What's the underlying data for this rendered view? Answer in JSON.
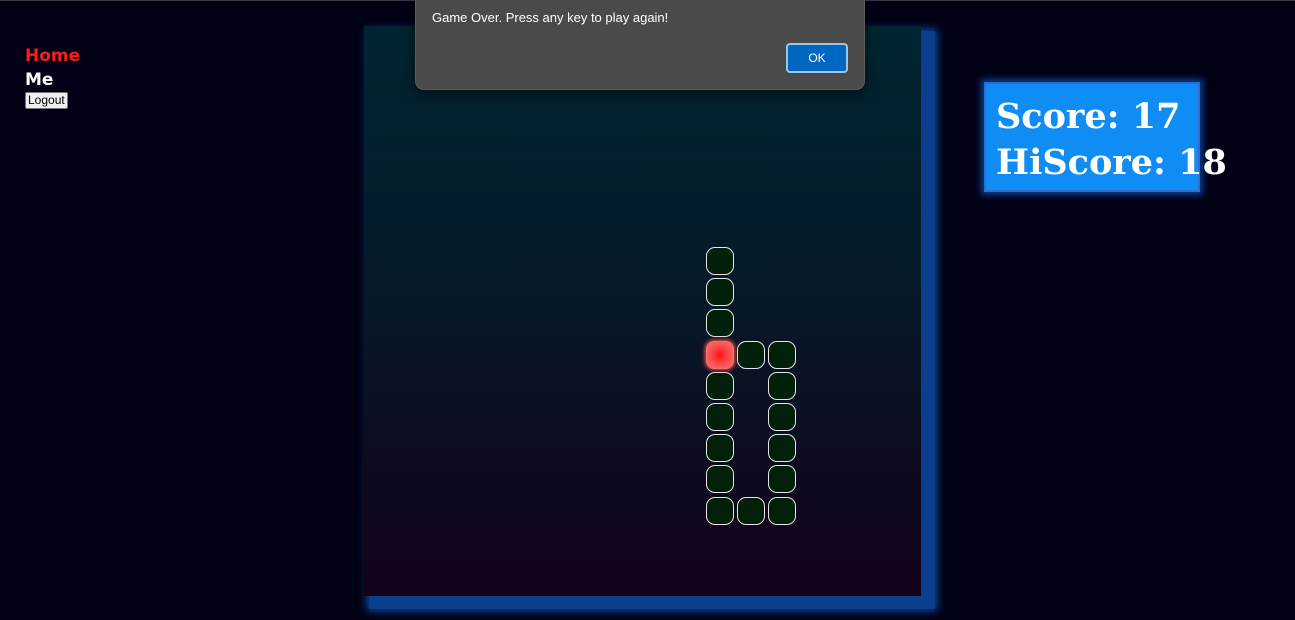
{
  "nav": {
    "home": "Home",
    "me": "Me",
    "logout": "Logout"
  },
  "score": {
    "score_label": "Score: 17",
    "hiscore_label": "HiScore: 18",
    "score": 17,
    "hiscore": 18
  },
  "alert": {
    "message": "Game Over. Press any key to play again!",
    "ok": "OK"
  },
  "game": {
    "colors": {
      "board_top": "#012430",
      "board_bottom": "#14021a",
      "snake": "#03200a",
      "food": "#ff1010",
      "score_bg": "#108df4"
    },
    "snake_cells": [
      [
        10,
        6
      ],
      [
        10,
        7
      ],
      [
        10,
        8
      ],
      [
        11,
        9
      ],
      [
        9,
        10
      ],
      [
        9,
        11
      ],
      [
        9,
        12
      ],
      [
        9,
        13
      ],
      [
        9,
        14
      ],
      [
        10,
        15
      ],
      [
        11,
        15
      ],
      [
        11,
        14
      ],
      [
        11,
        13
      ],
      [
        11,
        12
      ],
      [
        11,
        11
      ],
      [
        11,
        10
      ],
      [
        11,
        9
      ]
    ],
    "food_cell": [
      9,
      9
    ]
  }
}
